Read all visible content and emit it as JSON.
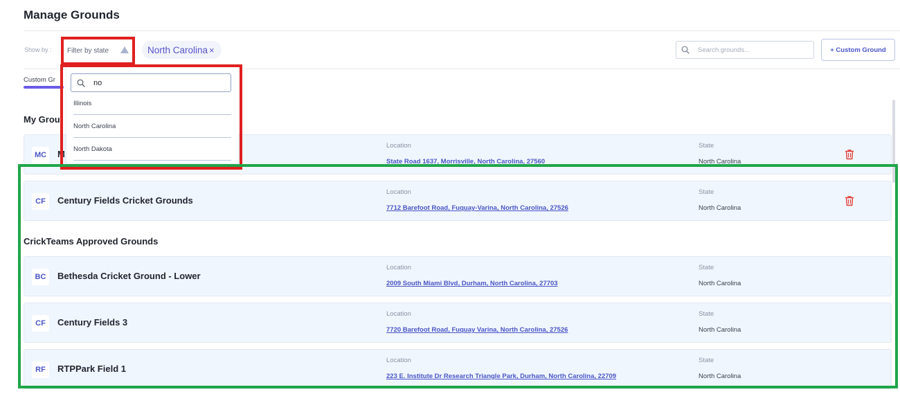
{
  "header": {
    "title": "Manage Grounds"
  },
  "filters": {
    "show_by_label": "Show by :",
    "filter_button_label": "Filter by state",
    "active_chip": {
      "label": "North Carolina",
      "remove_glyph": "×"
    }
  },
  "search": {
    "placeholder": "Search grounds...",
    "value": ""
  },
  "toolbar": {
    "custom_ground_label": "+ Custom Ground"
  },
  "tabs": [
    {
      "label": "Custom Gr"
    }
  ],
  "dropdown": {
    "search_value": "no",
    "options": [
      "Illinois",
      "North Carolina",
      "North Dakota"
    ]
  },
  "sections": {
    "my_grounds_title": "My Grou",
    "approved_title": "CrickTeams Approved Grounds"
  },
  "labels": {
    "location": "Location",
    "state": "State"
  },
  "my_grounds": [
    {
      "initials": "MC",
      "name": "M",
      "location": "State Road 1637, Morrisville, North Carolina, 27560",
      "state": "North Carolina"
    },
    {
      "initials": "CF",
      "name": "Century Fields Cricket Grounds",
      "location": "7712 Barefoot Road, Fuquay-Varina, North Carolina, 27526",
      "state": "North Carolina"
    }
  ],
  "approved_grounds": [
    {
      "initials": "BC",
      "name": "Bethesda Cricket Ground - Lower",
      "location": "2009 South Miami Blvd, Durham, North Carolina, 27703",
      "state": "North Carolina"
    },
    {
      "initials": "CF",
      "name": "Century Fields 3",
      "location": "7720 Barefoot Road, Fuquay Varina, North Carolina, 27526",
      "state": "North Carolina"
    },
    {
      "initials": "RF",
      "name": "RTPPark Field 1",
      "location": "223 E. Institute Dr Research Triangle Park, Durham, North Carolina, 22709",
      "state": "North Carolina"
    }
  ],
  "colors": {
    "accent": "#4a55c6",
    "row_background": "#f0f6fd",
    "delete_red": "#e0413a",
    "highlight_red": "#e02020",
    "highlight_green": "#1fa64a"
  },
  "icons": {
    "search": "search-icon",
    "delete": "trash-icon",
    "caret": "caret-up-icon",
    "remove": "close-icon"
  }
}
